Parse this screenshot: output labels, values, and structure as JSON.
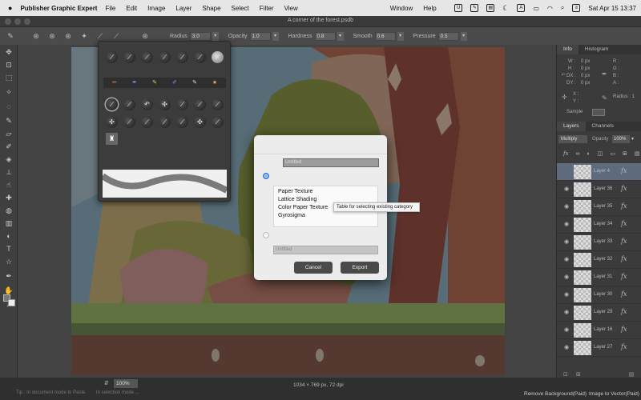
{
  "menubar": {
    "app_name": "Publisher Graphic Expert",
    "menus": [
      "File",
      "Edit",
      "Image",
      "Layer",
      "Shape",
      "Select",
      "Filter",
      "View",
      "Window",
      "Help"
    ],
    "datetime": "Sat Apr 15  13:37"
  },
  "document": {
    "title": "A corner of the forest.psdb"
  },
  "options": {
    "radius_label": "Radius",
    "radius_value": "3.0",
    "opacity_label": "Opacity",
    "opacity_value": "1.0",
    "hardness_label": "Hardness",
    "hardness_value": "0.8",
    "smooth_label": "Smooth",
    "smooth_value": "0.6",
    "pressure_label": "Pressure",
    "pressure_value": "0.5"
  },
  "panel": {
    "tabs": [
      "Info",
      "Histogram"
    ],
    "info": {
      "w": "W :",
      "w_val": "0 px",
      "h": "H :",
      "h_val": "0 px",
      "dx": "DX :",
      "dx_val": "0 px",
      "dy": "DY :",
      "dy_val": "0 px",
      "r": "R :",
      "g": "G :",
      "b": "B :",
      "a": "A :",
      "x": "X :",
      "y": "Y :",
      "radius": "Radius : 1"
    },
    "sample_label": "Sample",
    "layer_tabs": [
      "Layers",
      "Channels"
    ],
    "blend_mode": "Multiply",
    "opacity_label": "Opacity",
    "opacity_value": "100%",
    "layers": [
      {
        "name": "Layer 4",
        "selected": true
      },
      {
        "name": "Layer 36"
      },
      {
        "name": "Layer 35"
      },
      {
        "name": "Layer 34"
      },
      {
        "name": "Layer 33"
      },
      {
        "name": "Layer 32"
      },
      {
        "name": "Layer 31"
      },
      {
        "name": "Layer 30"
      },
      {
        "name": "Layer 29"
      },
      {
        "name": "Layer 16"
      },
      {
        "name": "Layer 27"
      }
    ]
  },
  "dialog": {
    "name_value": "Untitled",
    "categories": [
      "Paper Texture",
      "Lattice Shading",
      "Color Paper Texture",
      "Gyrosigma"
    ],
    "tooltip": "Table for selecting existing category",
    "new_category_placeholder": "Untitled",
    "cancel_label": "Cancel",
    "export_label": "Export"
  },
  "status": {
    "zoom": "100%",
    "dimensions": "1034 × 769 px, 72 dpi",
    "hint1": "Tip : In document mode to Paste",
    "hint2": "In selection mode ...",
    "remove_bg": "Remove Background(Paid)",
    "image_to_vector": "Image to Vector(Paid)"
  },
  "colors": {
    "accent": "#3f7ee8",
    "layer_selected": "#5d6b7d"
  }
}
